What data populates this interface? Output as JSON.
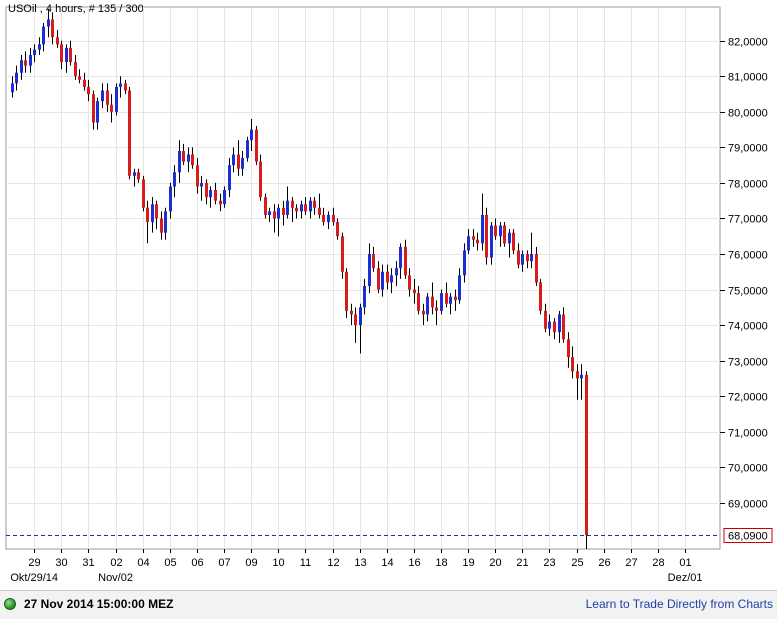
{
  "header": {
    "title": "USOil , 4 hours, # 135 / 300"
  },
  "status": {
    "time_label": "27 Nov 2014 15:00:00 MEZ",
    "link_label": "Learn to Trade Directly from Charts"
  },
  "colors": {
    "up": "#1c2fd6",
    "down": "#d61c1c",
    "wick": "#000000",
    "price_line": "#1c2fb0",
    "price_box": "#cc0000"
  },
  "chart_data": {
    "type": "candlestick",
    "title": "USOil , 4 hours, # 135 / 300",
    "ylim": [
      67.7,
      82.95
    ],
    "y_ticks": [
      69,
      70,
      71,
      72,
      73,
      74,
      75,
      76,
      77,
      78,
      79,
      80,
      81,
      82
    ],
    "y_tick_labels": [
      "69,0000",
      "70,0000",
      "71,0000",
      "72,0000",
      "73,0000",
      "74,0000",
      "75,0000",
      "76,0000",
      "77,0000",
      "78,0000",
      "79,0000",
      "80,0000",
      "81,0000",
      "82,0000"
    ],
    "x_ticks": [
      {
        "label": "29",
        "bar": 5
      },
      {
        "label": "30",
        "bar": 11
      },
      {
        "label": "31",
        "bar": 17
      },
      {
        "label": "02",
        "bar": 23
      },
      {
        "label": "04",
        "bar": 29
      },
      {
        "label": "05",
        "bar": 35
      },
      {
        "label": "06",
        "bar": 41
      },
      {
        "label": "07",
        "bar": 47
      },
      {
        "label": "09",
        "bar": 53
      },
      {
        "label": "10",
        "bar": 59
      },
      {
        "label": "11",
        "bar": 65
      },
      {
        "label": "12",
        "bar": 71
      },
      {
        "label": "13",
        "bar": 77
      },
      {
        "label": "14",
        "bar": 83
      },
      {
        "label": "16",
        "bar": 89
      },
      {
        "label": "18",
        "bar": 95
      },
      {
        "label": "19",
        "bar": 101
      },
      {
        "label": "20",
        "bar": 107
      },
      {
        "label": "21",
        "bar": 113
      },
      {
        "label": "23",
        "bar": 119
      },
      {
        "label": "25",
        "bar": 125
      },
      {
        "label": "26",
        "bar": 131
      },
      {
        "label": "27",
        "bar": 137
      },
      {
        "label": "28",
        "bar": 143
      },
      {
        "label": "01",
        "bar": 149
      }
    ],
    "sub_labels": [
      {
        "label": "Okt/29/14",
        "bar": 5
      },
      {
        "label": "Nov/02",
        "bar": 23
      },
      {
        "label": "Dez/01",
        "bar": 149
      }
    ],
    "last_price": 68.09,
    "last_price_label": "68,0900",
    "candles": [
      [
        80.55,
        81.0,
        80.4,
        80.8
      ],
      [
        80.8,
        81.3,
        80.6,
        81.1
      ],
      [
        81.1,
        81.6,
        80.9,
        81.45
      ],
      [
        81.45,
        81.7,
        81.1,
        81.3
      ],
      [
        81.3,
        81.8,
        81.1,
        81.6
      ],
      [
        81.6,
        81.9,
        81.4,
        81.75
      ],
      [
        81.75,
        82.1,
        81.6,
        81.9
      ],
      [
        81.9,
        82.5,
        81.7,
        82.4
      ],
      [
        82.4,
        82.9,
        82.1,
        82.6
      ],
      [
        82.6,
        82.8,
        81.9,
        82.1
      ],
      [
        82.1,
        82.3,
        81.8,
        81.9
      ],
      [
        81.9,
        82.0,
        81.2,
        81.4
      ],
      [
        81.4,
        81.9,
        81.1,
        81.8
      ],
      [
        81.8,
        82.0,
        81.3,
        81.4
      ],
      [
        81.4,
        81.6,
        80.9,
        81.0
      ],
      [
        81.0,
        81.2,
        80.8,
        80.9
      ],
      [
        80.9,
        81.1,
        80.6,
        80.7
      ],
      [
        80.7,
        80.9,
        80.3,
        80.5
      ],
      [
        80.5,
        80.6,
        79.5,
        79.7
      ],
      [
        79.7,
        80.4,
        79.5,
        80.3
      ],
      [
        80.3,
        80.8,
        80.1,
        80.6
      ],
      [
        80.6,
        80.8,
        80.0,
        80.2
      ],
      [
        80.2,
        80.5,
        79.7,
        80.0
      ],
      [
        80.0,
        80.8,
        79.9,
        80.7
      ],
      [
        80.7,
        81.0,
        80.4,
        80.8
      ],
      [
        80.8,
        80.9,
        80.5,
        80.6
      ],
      [
        80.6,
        80.7,
        78.1,
        78.2
      ],
      [
        78.2,
        78.4,
        77.9,
        78.3
      ],
      [
        78.3,
        78.4,
        78.0,
        78.1
      ],
      [
        78.1,
        78.2,
        77.2,
        77.3
      ],
      [
        77.3,
        77.5,
        76.3,
        76.9
      ],
      [
        76.9,
        77.6,
        76.6,
        77.4
      ],
      [
        77.4,
        77.5,
        76.7,
        77.0
      ],
      [
        77.0,
        77.2,
        76.4,
        76.6
      ],
      [
        76.6,
        77.3,
        76.4,
        77.2
      ],
      [
        77.2,
        78.0,
        77.0,
        77.9
      ],
      [
        77.9,
        78.5,
        77.6,
        78.3
      ],
      [
        78.3,
        79.2,
        78.0,
        78.9
      ],
      [
        78.9,
        79.1,
        78.5,
        78.6
      ],
      [
        78.6,
        79.0,
        78.3,
        78.8
      ],
      [
        78.8,
        79.0,
        78.4,
        78.5
      ],
      [
        78.5,
        78.7,
        77.7,
        77.9
      ],
      [
        77.9,
        78.2,
        77.5,
        78.0
      ],
      [
        78.0,
        78.1,
        77.4,
        77.6
      ],
      [
        77.6,
        77.9,
        77.3,
        77.8
      ],
      [
        77.8,
        78.0,
        77.4,
        77.5
      ],
      [
        77.5,
        77.7,
        77.2,
        77.4
      ],
      [
        77.4,
        77.9,
        77.3,
        77.8
      ],
      [
        77.8,
        78.7,
        77.6,
        78.5
      ],
      [
        78.5,
        79.0,
        78.3,
        78.8
      ],
      [
        78.8,
        79.2,
        78.2,
        78.4
      ],
      [
        78.4,
        78.9,
        78.2,
        78.7
      ],
      [
        78.7,
        79.3,
        78.6,
        79.2
      ],
      [
        79.2,
        79.8,
        78.9,
        79.5
      ],
      [
        79.5,
        79.6,
        78.5,
        78.6
      ],
      [
        78.6,
        78.8,
        77.5,
        77.6
      ],
      [
        77.6,
        77.7,
        77.0,
        77.1
      ],
      [
        77.1,
        77.3,
        76.9,
        77.2
      ],
      [
        77.2,
        77.4,
        76.6,
        77.0
      ],
      [
        77.0,
        77.4,
        76.5,
        77.3
      ],
      [
        77.3,
        77.5,
        76.8,
        77.1
      ],
      [
        77.1,
        77.9,
        77.0,
        77.5
      ],
      [
        77.5,
        77.6,
        76.9,
        77.3
      ],
      [
        77.3,
        77.4,
        77.0,
        77.2
      ],
      [
        77.2,
        77.5,
        77.0,
        77.4
      ],
      [
        77.4,
        77.6,
        77.1,
        77.2
      ],
      [
        77.2,
        77.6,
        77.0,
        77.5
      ],
      [
        77.5,
        77.6,
        77.1,
        77.3
      ],
      [
        77.3,
        77.7,
        77.0,
        77.1
      ],
      [
        77.1,
        77.3,
        76.8,
        76.9
      ],
      [
        76.9,
        77.2,
        76.7,
        77.1
      ],
      [
        77.1,
        77.3,
        76.8,
        76.9
      ],
      [
        76.9,
        77.0,
        76.4,
        76.5
      ],
      [
        76.5,
        76.6,
        75.3,
        75.5
      ],
      [
        75.5,
        75.6,
        74.2,
        74.4
      ],
      [
        74.4,
        74.6,
        74.0,
        74.3
      ],
      [
        74.3,
        74.5,
        73.5,
        74.0
      ],
      [
        74.0,
        74.6,
        73.2,
        74.5
      ],
      [
        74.5,
        75.3,
        74.3,
        75.1
      ],
      [
        75.1,
        76.3,
        74.9,
        76.0
      ],
      [
        76.0,
        76.2,
        75.5,
        75.6
      ],
      [
        75.6,
        75.8,
        74.9,
        75.0
      ],
      [
        75.0,
        75.7,
        74.8,
        75.5
      ],
      [
        75.5,
        75.7,
        75.0,
        75.2
      ],
      [
        75.2,
        75.6,
        74.9,
        75.4
      ],
      [
        75.4,
        75.8,
        75.1,
        75.6
      ],
      [
        75.6,
        76.3,
        75.3,
        76.2
      ],
      [
        76.2,
        76.4,
        75.3,
        75.4
      ],
      [
        75.4,
        75.6,
        74.8,
        75.0
      ],
      [
        75.0,
        75.3,
        74.6,
        74.9
      ],
      [
        74.9,
        75.1,
        74.3,
        74.4
      ],
      [
        74.4,
        74.6,
        74.0,
        74.3
      ],
      [
        74.3,
        74.9,
        74.1,
        74.8
      ],
      [
        74.8,
        75.2,
        74.3,
        74.5
      ],
      [
        74.5,
        74.7,
        74.0,
        74.4
      ],
      [
        74.4,
        75.0,
        74.3,
        74.9
      ],
      [
        74.9,
        75.2,
        74.5,
        74.6
      ],
      [
        74.6,
        74.9,
        74.3,
        74.8
      ],
      [
        74.8,
        75.0,
        74.4,
        74.7
      ],
      [
        74.7,
        75.6,
        74.6,
        75.4
      ],
      [
        75.4,
        76.3,
        75.2,
        76.1
      ],
      [
        76.1,
        76.7,
        76.0,
        76.5
      ],
      [
        76.5,
        76.7,
        76.2,
        76.4
      ],
      [
        76.4,
        76.6,
        76.1,
        76.3
      ],
      [
        76.3,
        77.7,
        76.1,
        77.1
      ],
      [
        77.1,
        77.3,
        75.7,
        75.9
      ],
      [
        75.9,
        76.9,
        75.7,
        76.8
      ],
      [
        76.8,
        77.0,
        76.4,
        76.5
      ],
      [
        76.5,
        76.9,
        76.2,
        76.8
      ],
      [
        76.8,
        76.9,
        76.2,
        76.3
      ],
      [
        76.3,
        76.7,
        75.9,
        76.6
      ],
      [
        76.6,
        76.7,
        76.0,
        76.1
      ],
      [
        76.1,
        76.3,
        75.6,
        75.7
      ],
      [
        75.7,
        76.1,
        75.5,
        76.0
      ],
      [
        76.0,
        76.1,
        75.6,
        75.8
      ],
      [
        75.8,
        76.6,
        75.6,
        76.0
      ],
      [
        76.0,
        76.2,
        75.1,
        75.2
      ],
      [
        75.2,
        75.3,
        74.3,
        74.4
      ],
      [
        74.4,
        74.6,
        73.8,
        73.9
      ],
      [
        73.9,
        74.3,
        73.7,
        74.1
      ],
      [
        74.1,
        74.2,
        73.6,
        73.8
      ],
      [
        73.8,
        74.4,
        73.5,
        74.3
      ],
      [
        74.3,
        74.5,
        73.5,
        73.6
      ],
      [
        73.6,
        73.8,
        72.8,
        73.1
      ],
      [
        73.1,
        73.4,
        72.5,
        72.7
      ],
      [
        72.7,
        72.9,
        71.9,
        72.5
      ],
      [
        72.5,
        72.9,
        71.9,
        72.6
      ],
      [
        72.6,
        72.7,
        67.7,
        68.09
      ]
    ]
  }
}
